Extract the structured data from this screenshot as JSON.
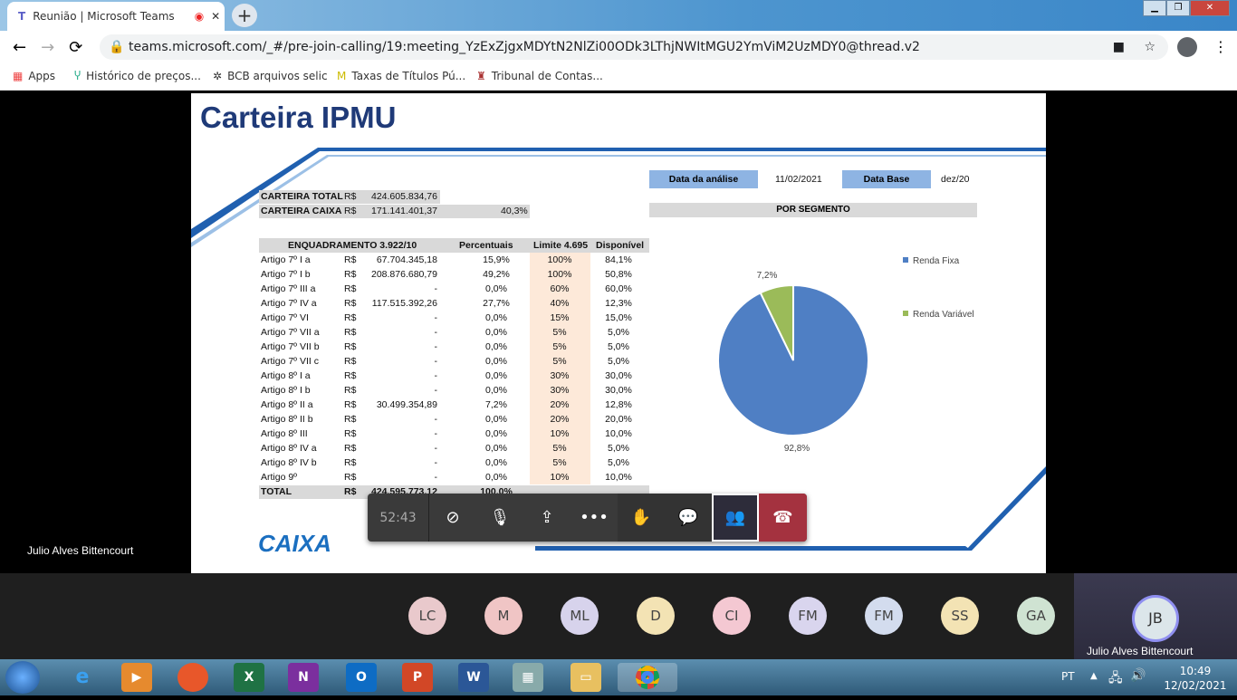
{
  "browser": {
    "tab_title": "Reunião | Microsoft Teams",
    "url": "teams.microsoft.com/_#/pre-join-calling/19:meeting_YzExZjgxMDYtN2NlZi00ODk3LThjNWItMGU2YmViM2UzMDY0@thread.v2",
    "bookmarks": [
      "Apps",
      "Histórico de preços...",
      "BCB arquivos selic",
      "Taxas de Títulos Pú...",
      "Tribunal de Contas..."
    ]
  },
  "slide": {
    "title": "Carteira IPMU",
    "analysis_label": "Data da análise",
    "analysis_date": "11/02/2021",
    "base_label": "Data Base",
    "base_value": "dez/20",
    "segment_header": "POR SEGMENTO",
    "carteira_total": {
      "label": "CARTEIRA TOTAL",
      "currency": "R$",
      "value": "424.605.834,76"
    },
    "carteira_caixa": {
      "label": "CARTEIRA CAIXA",
      "currency": "R$",
      "value": "171.141.401,37",
      "pct": "40,3%"
    },
    "table": {
      "headers": [
        "ENQUADRAMENTO 3.922/10",
        "Percentuais",
        "Limite 4.695",
        "Disponível"
      ],
      "rows": [
        [
          "Artigo 7º I a",
          "R$",
          "67.704.345,18",
          "15,9%",
          "100%",
          "84,1%"
        ],
        [
          "Artigo 7º I b",
          "R$",
          "208.876.680,79",
          "49,2%",
          "100%",
          "50,8%"
        ],
        [
          "Artigo 7º III a",
          "R$",
          "-",
          "0,0%",
          "60%",
          "60,0%"
        ],
        [
          "Artigo 7º IV a",
          "R$",
          "117.515.392,26",
          "27,7%",
          "40%",
          "12,3%"
        ],
        [
          "Artigo 7º VI",
          "R$",
          "-",
          "0,0%",
          "15%",
          "15,0%"
        ],
        [
          "Artigo 7º VII a",
          "R$",
          "-",
          "0,0%",
          "5%",
          "5,0%"
        ],
        [
          "Artigo 7º VII b",
          "R$",
          "-",
          "0,0%",
          "5%",
          "5,0%"
        ],
        [
          "Artigo 7º VII c",
          "R$",
          "-",
          "0,0%",
          "5%",
          "5,0%"
        ],
        [
          "Artigo 8º I a",
          "R$",
          "-",
          "0,0%",
          "30%",
          "30,0%"
        ],
        [
          "Artigo 8º I b",
          "R$",
          "-",
          "0,0%",
          "30%",
          "30,0%"
        ],
        [
          "Artigo 8º II a",
          "R$",
          "30.499.354,89",
          "7,2%",
          "20%",
          "12,8%"
        ],
        [
          "Artigo 8º II b",
          "R$",
          "-",
          "0,0%",
          "20%",
          "20,0%"
        ],
        [
          "Artigo 8º III",
          "R$",
          "-",
          "0,0%",
          "10%",
          "10,0%"
        ],
        [
          "Artigo 8º IV a",
          "R$",
          "-",
          "0,0%",
          "5%",
          "5,0%"
        ],
        [
          "Artigo 8º IV b",
          "R$",
          "-",
          "0,0%",
          "5%",
          "5,0%"
        ],
        [
          "Artigo 9º",
          "R$",
          "-",
          "0,0%",
          "10%",
          "10,0%"
        ]
      ],
      "total": [
        "TOTAL",
        "R$",
        "424.595.773,12",
        "100,0%"
      ]
    },
    "logo": "CAIXA",
    "presenter": "Julio Alves Bittencourt"
  },
  "chart_data": {
    "type": "pie",
    "labels": [
      "Renda Fixa",
      "Renda Variável"
    ],
    "values": [
      92.8,
      7.2
    ],
    "data_labels": [
      "92,8%",
      "7,2%"
    ],
    "colors": [
      "#4f7fc4",
      "#9bbb59"
    ],
    "legend": "right"
  },
  "meeting": {
    "timer": "52:43",
    "participants": [
      {
        "initials": "LC",
        "color": "#e9c9cc"
      },
      {
        "initials": "M",
        "color": "#f0c5c5"
      },
      {
        "initials": "ML",
        "color": "#d7d3ec"
      },
      {
        "initials": "D",
        "color": "#f3e3b4"
      },
      {
        "initials": "CI",
        "color": "#f4c8d2"
      },
      {
        "initials": "FM",
        "color": "#d9d5ee"
      },
      {
        "initials": "FM",
        "color": "#d3dcee"
      },
      {
        "initials": "SS",
        "color": "#f3e3b4"
      },
      {
        "initials": "GA",
        "color": "#cfe3d2"
      }
    ],
    "me": {
      "initials": "JB",
      "name": "Julio Alves Bittencourt"
    }
  },
  "taskbar": {
    "lang": "PT",
    "time": "10:49",
    "date": "12/02/2021"
  }
}
